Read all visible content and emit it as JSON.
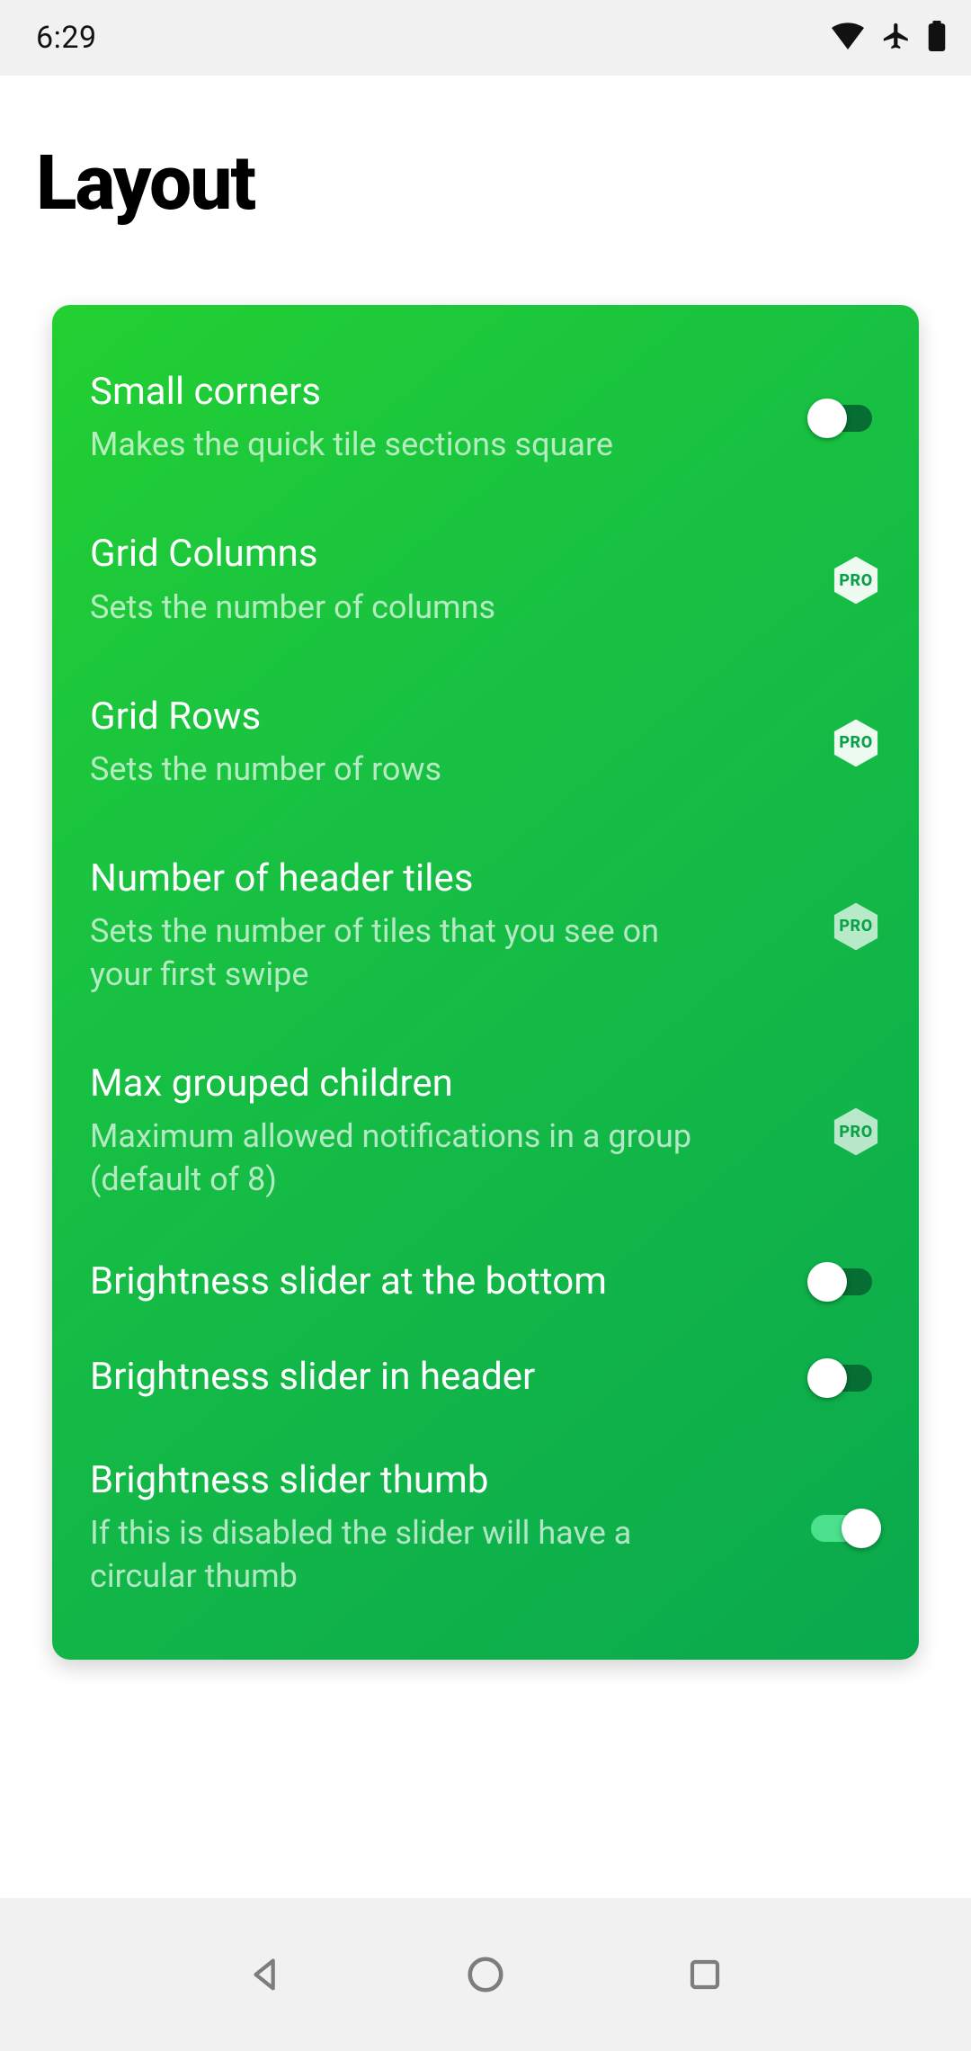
{
  "status": {
    "time": "6:29"
  },
  "page": {
    "title": "Layout"
  },
  "badges": {
    "pro": "PRO"
  },
  "settings": [
    {
      "title": "Small corners",
      "desc": "Makes the quick tile sections square",
      "kind": "switch",
      "on": false
    },
    {
      "title": "Grid Columns",
      "desc": "Sets the number of columns",
      "kind": "pro"
    },
    {
      "title": "Grid Rows",
      "desc": "Sets the number of rows",
      "kind": "pro"
    },
    {
      "title": "Number of header tiles",
      "desc": "Sets the number of tiles that you see on your first swipe",
      "kind": "pro"
    },
    {
      "title": "Max grouped children",
      "desc": "Maximum allowed notifications in a group (default of 8)",
      "kind": "pro"
    },
    {
      "title": "Brightness slider at the bottom",
      "desc": "",
      "kind": "switch",
      "on": false
    },
    {
      "title": "Brightness slider in header",
      "desc": "",
      "kind": "switch",
      "on": false
    },
    {
      "title": "Brightness slider thumb",
      "desc": "If this is disabled the slider will have a circular thumb",
      "kind": "switch",
      "on": true
    }
  ]
}
